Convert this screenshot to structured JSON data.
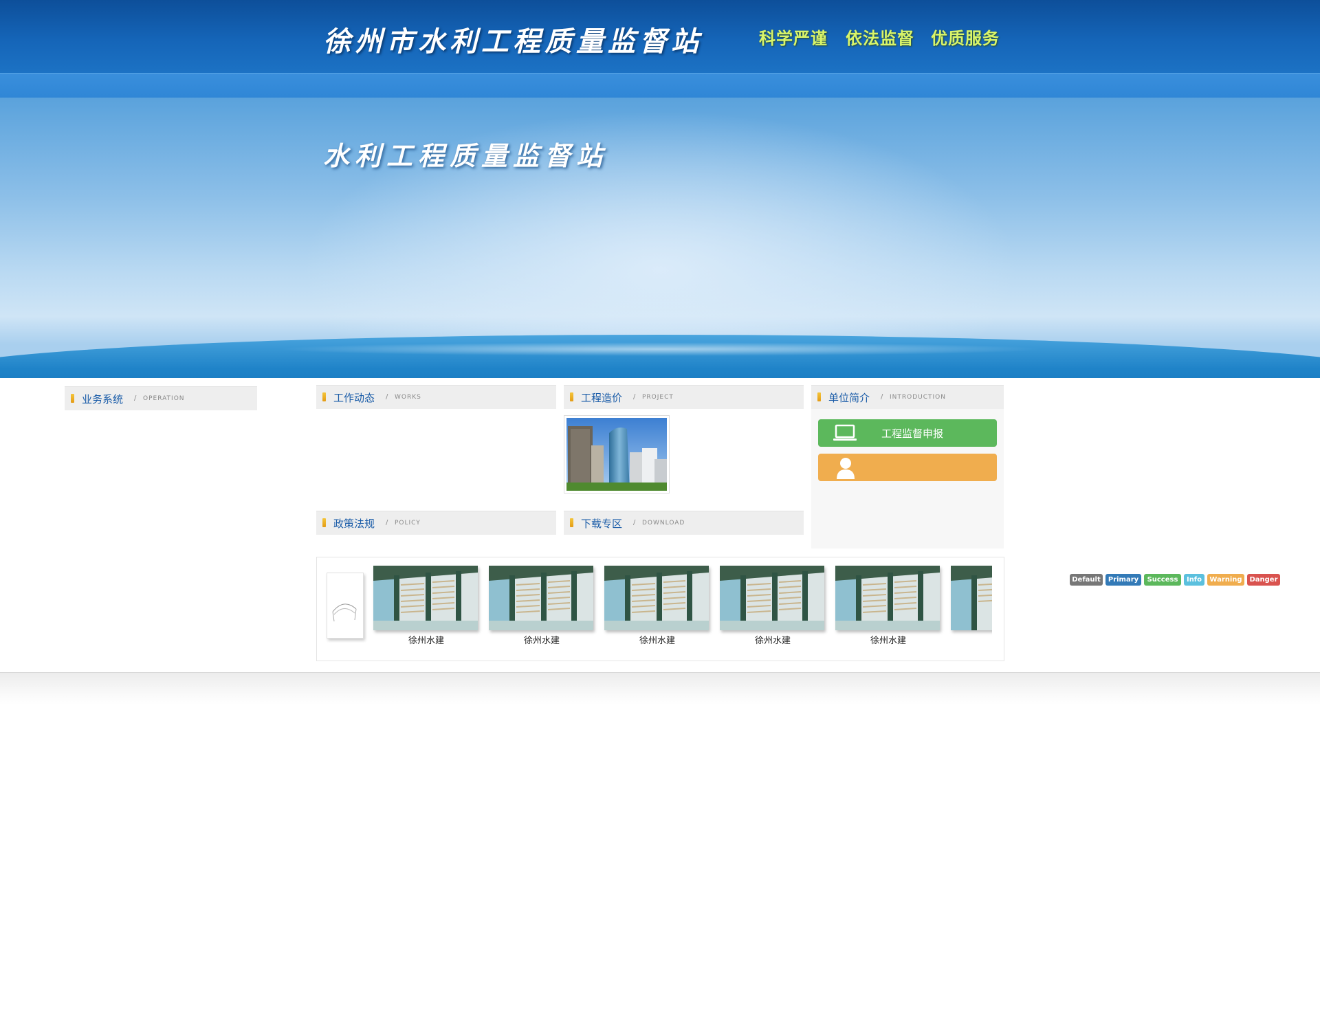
{
  "header": {
    "site_title": "徐州市水利工程质量监督站",
    "slogans": [
      "科学严谨",
      "依法监督",
      "优质服务"
    ]
  },
  "banner": {
    "title": "水利工程质量监督站"
  },
  "panels": {
    "operation": {
      "title": "业务系统",
      "sep": "/",
      "en": "OPERATION"
    },
    "works": {
      "title": "工作动态",
      "sep": "/",
      "en": "WORKS"
    },
    "project": {
      "title": "工程造价",
      "sep": "/",
      "en": "PROJECT"
    },
    "introduction": {
      "title": "单位简介",
      "sep": "/",
      "en": "INTRODUCTION"
    },
    "policy": {
      "title": "政策法规",
      "sep": "/",
      "en": "POLICY"
    },
    "download": {
      "title": "下载专区",
      "sep": "/",
      "en": "DOWNLOAD"
    }
  },
  "intro_buttons": {
    "report": {
      "label": "工程监督申报",
      "icon": "laptop-icon",
      "color": "#5cb85c"
    },
    "user": {
      "label": "",
      "icon": "user-icon",
      "color": "#f0ad4e"
    }
  },
  "gallery": {
    "items": [
      {
        "caption": "徐州水建"
      },
      {
        "caption": "徐州水建"
      },
      {
        "caption": "徐州水建"
      },
      {
        "caption": "徐州水建"
      },
      {
        "caption": "徐州水建"
      }
    ]
  },
  "labels": [
    {
      "text": "Default",
      "color": "#777777"
    },
    {
      "text": "Primary",
      "color": "#337ab7"
    },
    {
      "text": "Success",
      "color": "#5cb85c"
    },
    {
      "text": "Info",
      "color": "#5bc0de"
    },
    {
      "text": "Warning",
      "color": "#f0ad4e"
    },
    {
      "text": "Danger",
      "color": "#d9534f"
    }
  ]
}
